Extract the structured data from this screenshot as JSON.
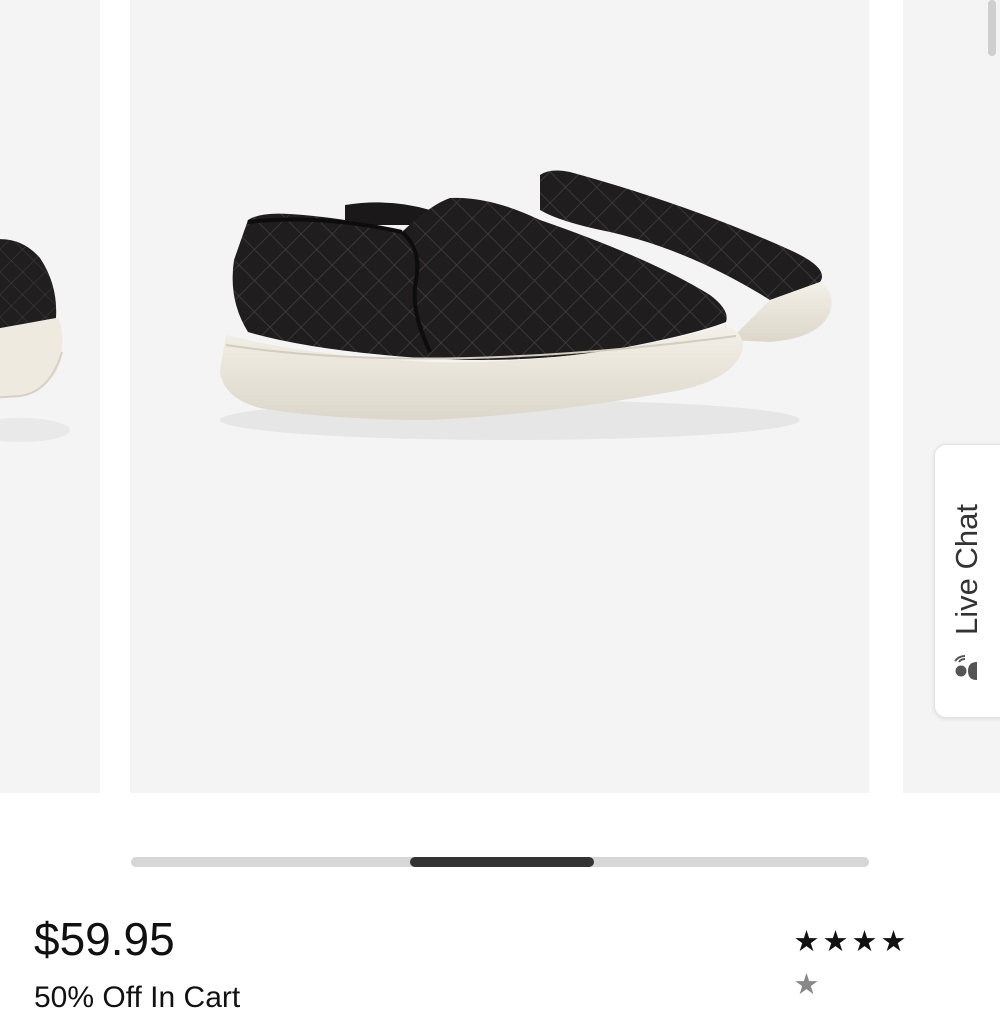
{
  "product": {
    "price": "$59.95",
    "promo": "50% Off In Cart",
    "rating": {
      "value": 4,
      "max": 5
    }
  },
  "live_chat": {
    "label": "Live Chat",
    "icon": "chat-person-icon"
  },
  "carousel": {
    "position": 0.5,
    "visible_fraction": 0.25
  },
  "colors": {
    "slide_bg": "#f4f4f4",
    "shoe_upper": "#1e1c1c",
    "shoe_sole": "#eeeae0",
    "scroll_track": "#d6d6d6",
    "scroll_thumb": "#333333"
  }
}
